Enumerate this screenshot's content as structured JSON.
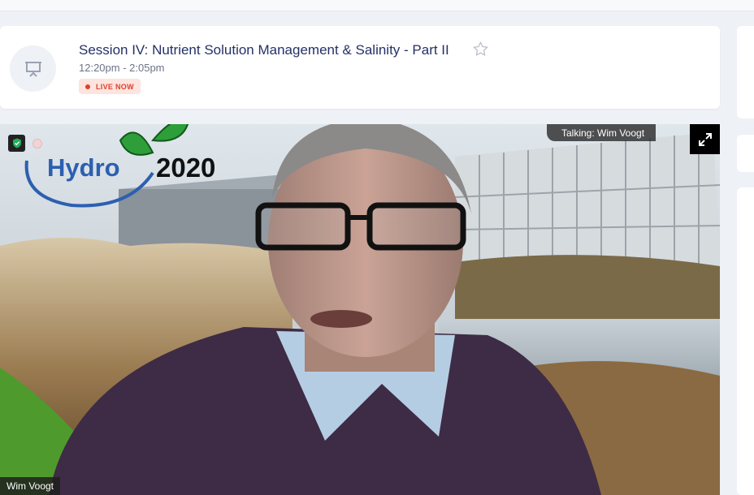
{
  "session": {
    "title": "Session IV: Nutrient Solution Management & Salinity - Part II",
    "time": "12:20pm - 2:05pm",
    "status": "LIVE NOW",
    "icon": "presentation-board-icon"
  },
  "video": {
    "talking_label": "Talking: Wim Voogt",
    "speaker_name": "Wim Voogt",
    "logo": {
      "text": "Hydro",
      "year": "2020"
    }
  },
  "colors": {
    "accent": "#243166",
    "live": "#e0402a",
    "live_bg": "#fde4df",
    "logo_blue": "#2d5fb0",
    "leaf_green": "#2e9e3a"
  }
}
